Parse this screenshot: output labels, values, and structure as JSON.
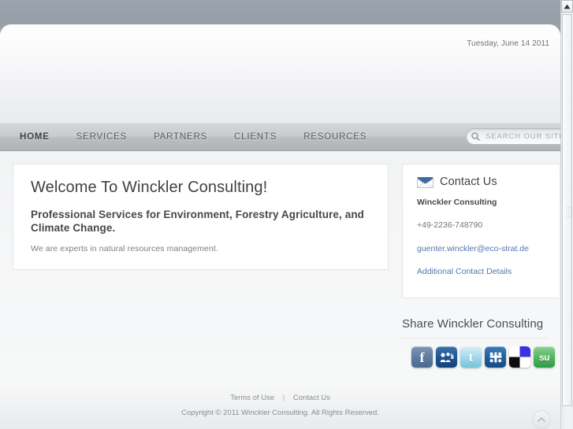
{
  "header": {
    "date": "Tuesday, June 14 2011"
  },
  "nav": {
    "items": [
      {
        "label": "HOME",
        "active": true
      },
      {
        "label": "SERVICES",
        "active": false
      },
      {
        "label": "PARTNERS",
        "active": false
      },
      {
        "label": "CLIENTS",
        "active": false
      },
      {
        "label": "RESOURCES",
        "active": false
      }
    ]
  },
  "search": {
    "icon": "search-icon",
    "placeholder": "SEARCH OUR SITE",
    "value": ""
  },
  "main": {
    "heading": "Welcome To Winckler Consulting!",
    "subheading": "Professional Services for Environment, Forestry Agriculture, and Climate Change.",
    "paragraph": "We are experts in natural resources management."
  },
  "sidebar": {
    "contact": {
      "icon": "envelope-icon",
      "title": "Contact Us",
      "company": "Winckler Consulting",
      "phone": "+49-2236-748790",
      "email": "guenter.winckler@eco-strat.de",
      "details_link": "Additional Contact Details"
    },
    "share": {
      "title": "Share Winckler Consulting",
      "icons": [
        {
          "name": "facebook-share-icon",
          "glyph": "f",
          "color": "#6a85a8",
          "color2": "#4f6c94"
        },
        {
          "name": "myspace-share-icon",
          "glyph": "♟",
          "color": "#2a5f9e",
          "color2": "#14447f"
        },
        {
          "name": "twitter-share-icon",
          "glyph": "t",
          "color": "#9fd8e8",
          "color2": "#6cbcd4"
        },
        {
          "name": "digg-share-icon",
          "glyph": "✤",
          "color": "#2c6aa8",
          "color2": "#17508c"
        },
        {
          "name": "delicious-share-icon",
          "glyph": "",
          "color": "#ffffff",
          "color2": "#e8e9ea"
        },
        {
          "name": "stumbleupon-share-icon",
          "glyph": "su",
          "color": "#6cc070",
          "color2": "#34a24a"
        }
      ]
    }
  },
  "footer": {
    "terms_label": "Terms of Use",
    "separator": "|",
    "contact_label": "Contact Us",
    "copyright": "Copyright © 2011 Winckler Consulting. All Rights Reserved.",
    "to_top_icon": "chevron-up-icon"
  },
  "scrollbar": {
    "up_icon": "scroll-up-arrow-icon"
  },
  "colors": {
    "link": "#5478ac",
    "page_bg": "#a3abb2",
    "nav_bg": "#c3c7ca"
  }
}
